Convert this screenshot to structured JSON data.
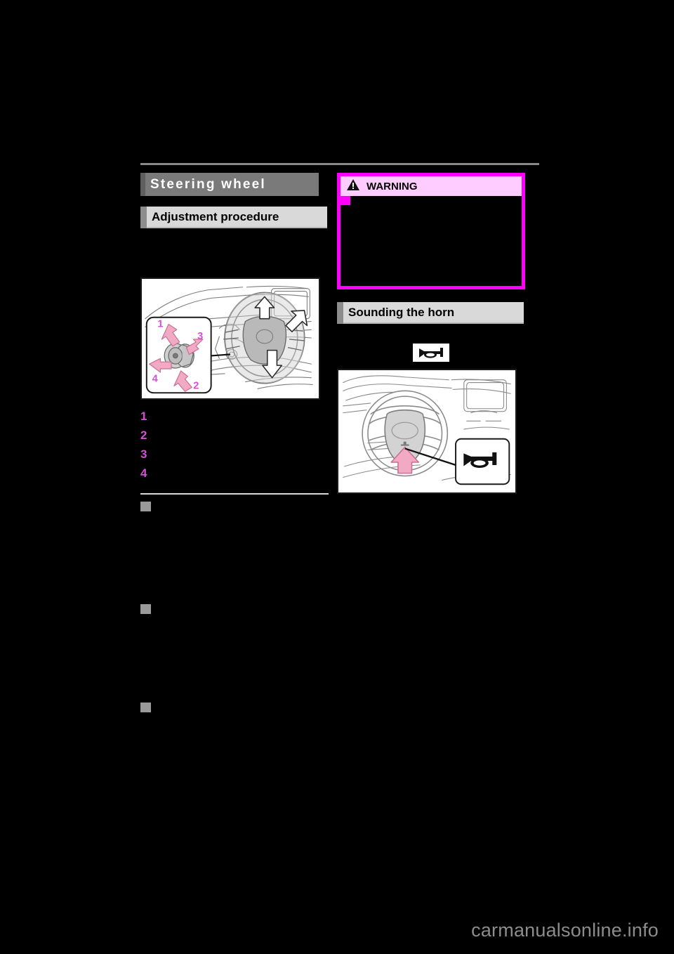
{
  "document": {
    "type": "car-owners-manual-page",
    "watermark": "carmanualsonline.info"
  },
  "left_column": {
    "chapter_header": "Steering wheel",
    "section_header": "Adjustment procedure",
    "figure": {
      "name": "steering-wheel-adjustment-illustration",
      "caption": "",
      "inset_callouts": [
        "1",
        "2",
        "3",
        "4"
      ]
    },
    "steps": [
      {
        "number": "1",
        "text": ""
      },
      {
        "number": "2",
        "text": ""
      },
      {
        "number": "3",
        "text": ""
      },
      {
        "number": "4",
        "text": ""
      }
    ],
    "subheadings": [
      {
        "text": ""
      },
      {
        "text": ""
      },
      {
        "text": ""
      }
    ]
  },
  "right_column": {
    "warning": {
      "title": "WARNING",
      "icon": "warning-triangle-icon",
      "body": ""
    },
    "section_header": "Sounding the horn",
    "lead_text": "",
    "symbol": "horn-icon",
    "figure": {
      "name": "horn-location-illustration",
      "caption": ""
    }
  },
  "colors": {
    "accent_magenta": "#ff00ff",
    "warning_fill": "#ffccff",
    "callout_number": "#d44fd4",
    "chapter_header_bg": "#7a7a7a",
    "section_header_bg": "#d9d9d9",
    "page_background": "#000000",
    "watermark": "#8c8c8c"
  }
}
